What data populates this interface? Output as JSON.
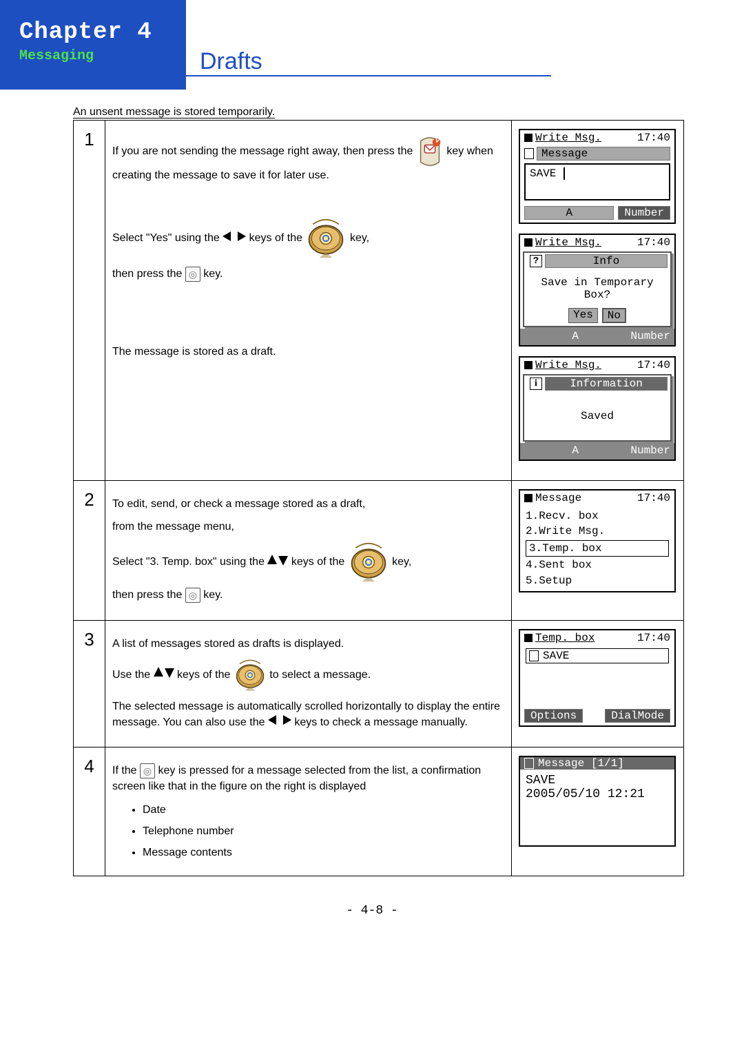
{
  "chapter": {
    "title": "Chapter 4",
    "subtitle": "Messaging"
  },
  "section_title": "Drafts",
  "intro": "An unsent message is stored temporarily.",
  "step1": {
    "num": "1",
    "p1a": "If you are not sending the message right away, then press the ",
    "p1b": " key when creating the message to save it for later use.",
    "p2a": "Select \"Yes\" using the ",
    "p2b": " keys of the ",
    "p2c": " key,",
    "p3a": "then press the ",
    "p3b": " key.",
    "p4": "The message is stored as a draft."
  },
  "step2": {
    "num": "2",
    "p1": "To edit, send, or check a message stored as a draft,",
    "p2": "from the message menu,",
    "p3a": "Select \"3. Temp. box\" using the ",
    "p3b": " keys of the ",
    "p3c": " key,",
    "p4a": "then press the ",
    "p4b": " key."
  },
  "step3": {
    "num": "3",
    "p1": "A list of messages stored as drafts is displayed.",
    "p2a": "Use the  ",
    "p2b": " keys of the ",
    "p2c": " to select a message.",
    "p3": "The selected message is automatically scrolled horizontally to display the entire message. You can also use the ",
    "p3b": " keys to check a message manually."
  },
  "step4": {
    "num": "4",
    "p1a": "If the ",
    "p1b": " key is pressed for a message selected from the list, a confirmation screen like that in the figure on the right is displayed",
    "b1": "Date",
    "b2": "Telephone number",
    "b3": "Message contents"
  },
  "screens": {
    "s1a": {
      "title": "Write Msg.",
      "time": "17:40",
      "subtitle": "Message",
      "body": "SAVE",
      "footL": "A",
      "footR": "Number"
    },
    "s1b": {
      "title": "Write Msg.",
      "time": "17:40",
      "infolabel": "Info",
      "line1": "Save in Temporary",
      "line2": "Box?",
      "yes": "Yes",
      "no": "No",
      "footL": "A",
      "footR": "Number"
    },
    "s1c": {
      "title": "Write Msg.",
      "time": "17:40",
      "infolabel": "Information",
      "body": "Saved",
      "footL": "A",
      "footR": "Number"
    },
    "s2": {
      "title": "Message",
      "time": "17:40",
      "i1": "1.Recv. box",
      "i2": "2.Write Msg.",
      "i3": "3.Temp. box",
      "i4": "4.Sent box",
      "i5": "5.Setup"
    },
    "s3": {
      "title": "Temp. box",
      "time": "17:40",
      "item": "SAVE",
      "footL": "Options",
      "footR": "DialMode"
    },
    "s4": {
      "title": "Message [1/1]",
      "line1": "SAVE",
      "line2": "2005/05/10 12:21"
    }
  },
  "pagenum": "- 4-8 -",
  "glyphs": {
    "center_key": "◎"
  }
}
